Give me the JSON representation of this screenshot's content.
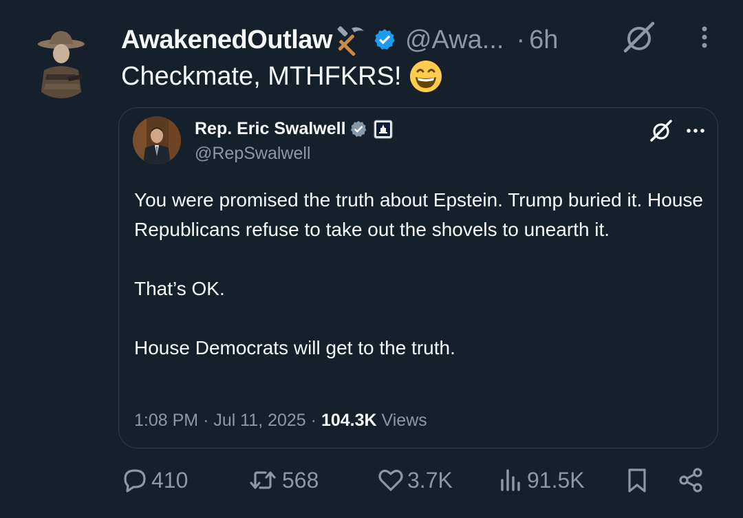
{
  "post": {
    "author_name": "AwakenedOutlaw",
    "author_handle": "@Awa...",
    "separator": "·",
    "time_ago": "6h",
    "text": "Checkmate, MTHFKRS!",
    "name_emoji_icon": "hammer-and-pick-icon",
    "text_emoji_icon": "grinning-face-icon"
  },
  "quote": {
    "author_name": "Rep. Eric Swalwell",
    "author_handle": "@RepSwalwell",
    "paragraphs": [
      "You were promised the truth about Epstein. Trump buried it. House Republicans refuse to take out the shovels to unearth it.",
      "That’s OK.",
      "House Democrats will get to the truth."
    ],
    "meta": {
      "time": "1:08 PM",
      "sep1": "·",
      "date": "Jul 11, 2025",
      "sep2": "·",
      "views_count": "104.3K",
      "views_label": "Views"
    }
  },
  "actions": {
    "replies": "410",
    "reposts": "568",
    "likes": "3.7K",
    "views": "91.5K"
  },
  "colors": {
    "background": "#15202b",
    "text": "#f7f9f9",
    "muted": "#8b98a5",
    "verified": "#1d9bf0",
    "quote_border": "#2f3b47"
  }
}
